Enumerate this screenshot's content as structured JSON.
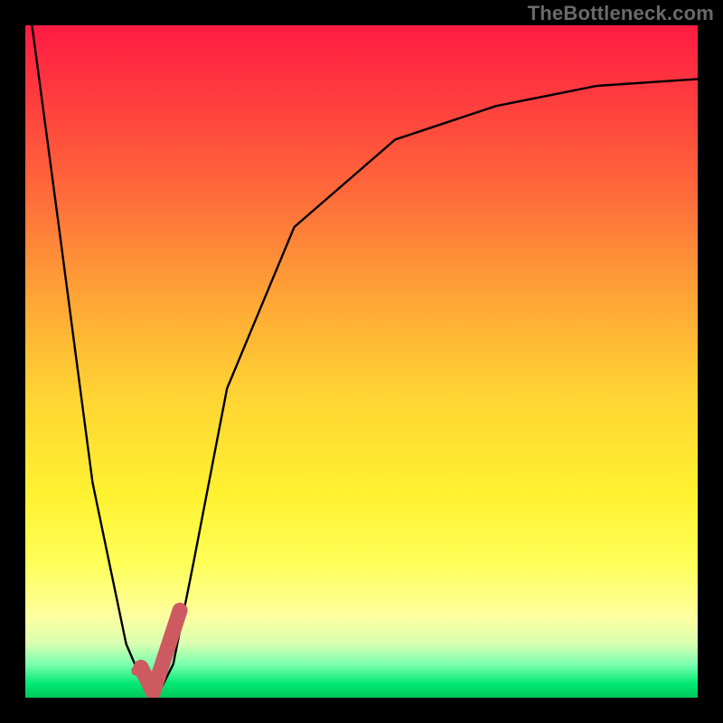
{
  "watermark": "TheBottleneck.com",
  "chart_data": {
    "type": "line",
    "title": "",
    "xlabel": "",
    "ylabel": "",
    "xlim": [
      0,
      100
    ],
    "ylim": [
      0,
      100
    ],
    "series": [
      {
        "name": "bottleneck-curve",
        "x": [
          1,
          5,
          10,
          15,
          18,
          20,
          22,
          25,
          30,
          40,
          55,
          70,
          85,
          100
        ],
        "values": [
          100,
          70,
          32,
          8,
          1,
          1,
          5,
          20,
          46,
          70,
          83,
          88,
          91,
          92
        ]
      }
    ],
    "markers": [
      {
        "name": "optimal-dot",
        "x": 16.5,
        "y": 4,
        "color": "#cc5a60",
        "size": 11
      },
      {
        "name": "optimal-tick",
        "type": "path",
        "color": "#cc5a60",
        "width": 17,
        "points": [
          {
            "x": 17.2,
            "y": 4.5
          },
          {
            "x": 19.0,
            "y": 0.8
          },
          {
            "x": 23.0,
            "y": 13.0
          }
        ]
      }
    ],
    "background_gradient": {
      "top": "#ff1b42",
      "mid": "#ffe733",
      "bottom": "#00c858"
    }
  }
}
